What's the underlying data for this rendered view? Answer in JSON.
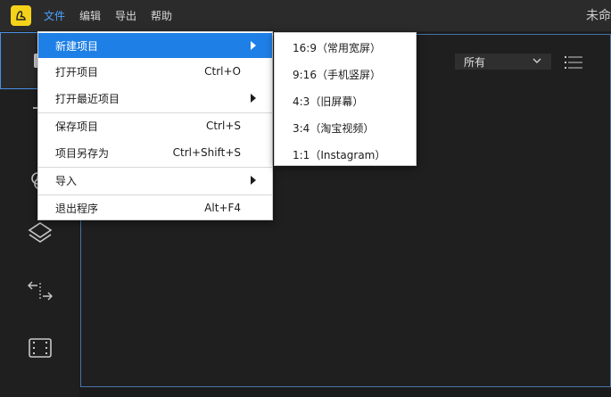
{
  "menubar": {
    "items": [
      {
        "label": "文件",
        "active": true
      },
      {
        "label": "编辑",
        "active": false
      },
      {
        "label": "导出",
        "active": false
      },
      {
        "label": "帮助",
        "active": false
      }
    ],
    "title_partial": "未命"
  },
  "sidebar": {
    "icons": [
      "clip-icon",
      "text-icon",
      "filter-icon",
      "layers-icon",
      "transition-icon",
      "film-icon"
    ]
  },
  "workspace": {
    "filter": {
      "value": "所有"
    }
  },
  "file_menu": {
    "items": [
      {
        "label": "新建项目",
        "shortcut": "",
        "submenu": true,
        "highlighted": true
      },
      {
        "label": "打开项目",
        "shortcut": "Ctrl+O",
        "submenu": false
      },
      {
        "label": "打开最近项目",
        "shortcut": "",
        "submenu": true
      },
      {
        "label": "保存项目",
        "shortcut": "Ctrl+S",
        "submenu": false
      },
      {
        "label": "项目另存为",
        "shortcut": "Ctrl+Shift+S",
        "submenu": false
      },
      {
        "label": "导入",
        "shortcut": "",
        "submenu": true
      },
      {
        "label": "退出程序",
        "shortcut": "Alt+F4",
        "submenu": false
      }
    ]
  },
  "new_project_submenu": {
    "items": [
      "16:9（常用宽屏）",
      "9:16（手机竖屏）",
      "4:3（旧屏幕）",
      "3:4（淘宝视频）",
      "1:1（Instagram）"
    ]
  },
  "colors": {
    "accent": "#1e7fe6",
    "logo": "#f5d21a",
    "active_menu": "#4aa3ff",
    "background": "#1b1b1b"
  }
}
